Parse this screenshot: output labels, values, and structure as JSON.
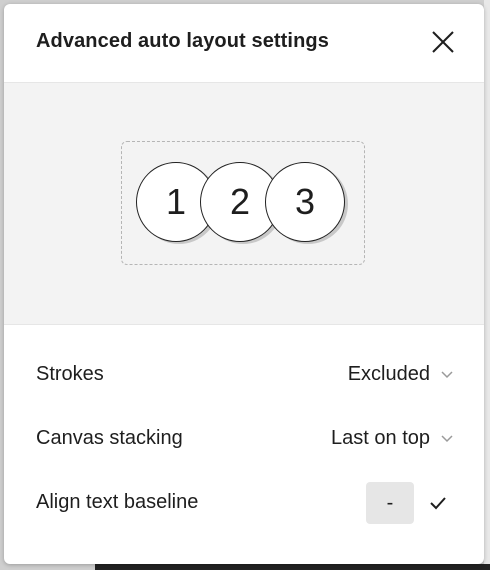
{
  "dialog": {
    "title": "Advanced auto layout settings"
  },
  "preview": {
    "items": [
      "1",
      "2",
      "3"
    ]
  },
  "settings": {
    "strokes": {
      "label": "Strokes",
      "value": "Excluded"
    },
    "canvas_stacking": {
      "label": "Canvas stacking",
      "value": "Last on top"
    },
    "align_text_baseline": {
      "label": "Align text baseline",
      "off_label": "-",
      "on_icon": "checkmark-icon",
      "selected": "off"
    }
  },
  "icons": {
    "close": "close-icon",
    "dropdown": "chevron-down-icon"
  },
  "colors": {
    "text": "#1e1e1e",
    "preview_bg": "#f3f3f3",
    "selected_segment_bg": "#e6e6e6"
  }
}
